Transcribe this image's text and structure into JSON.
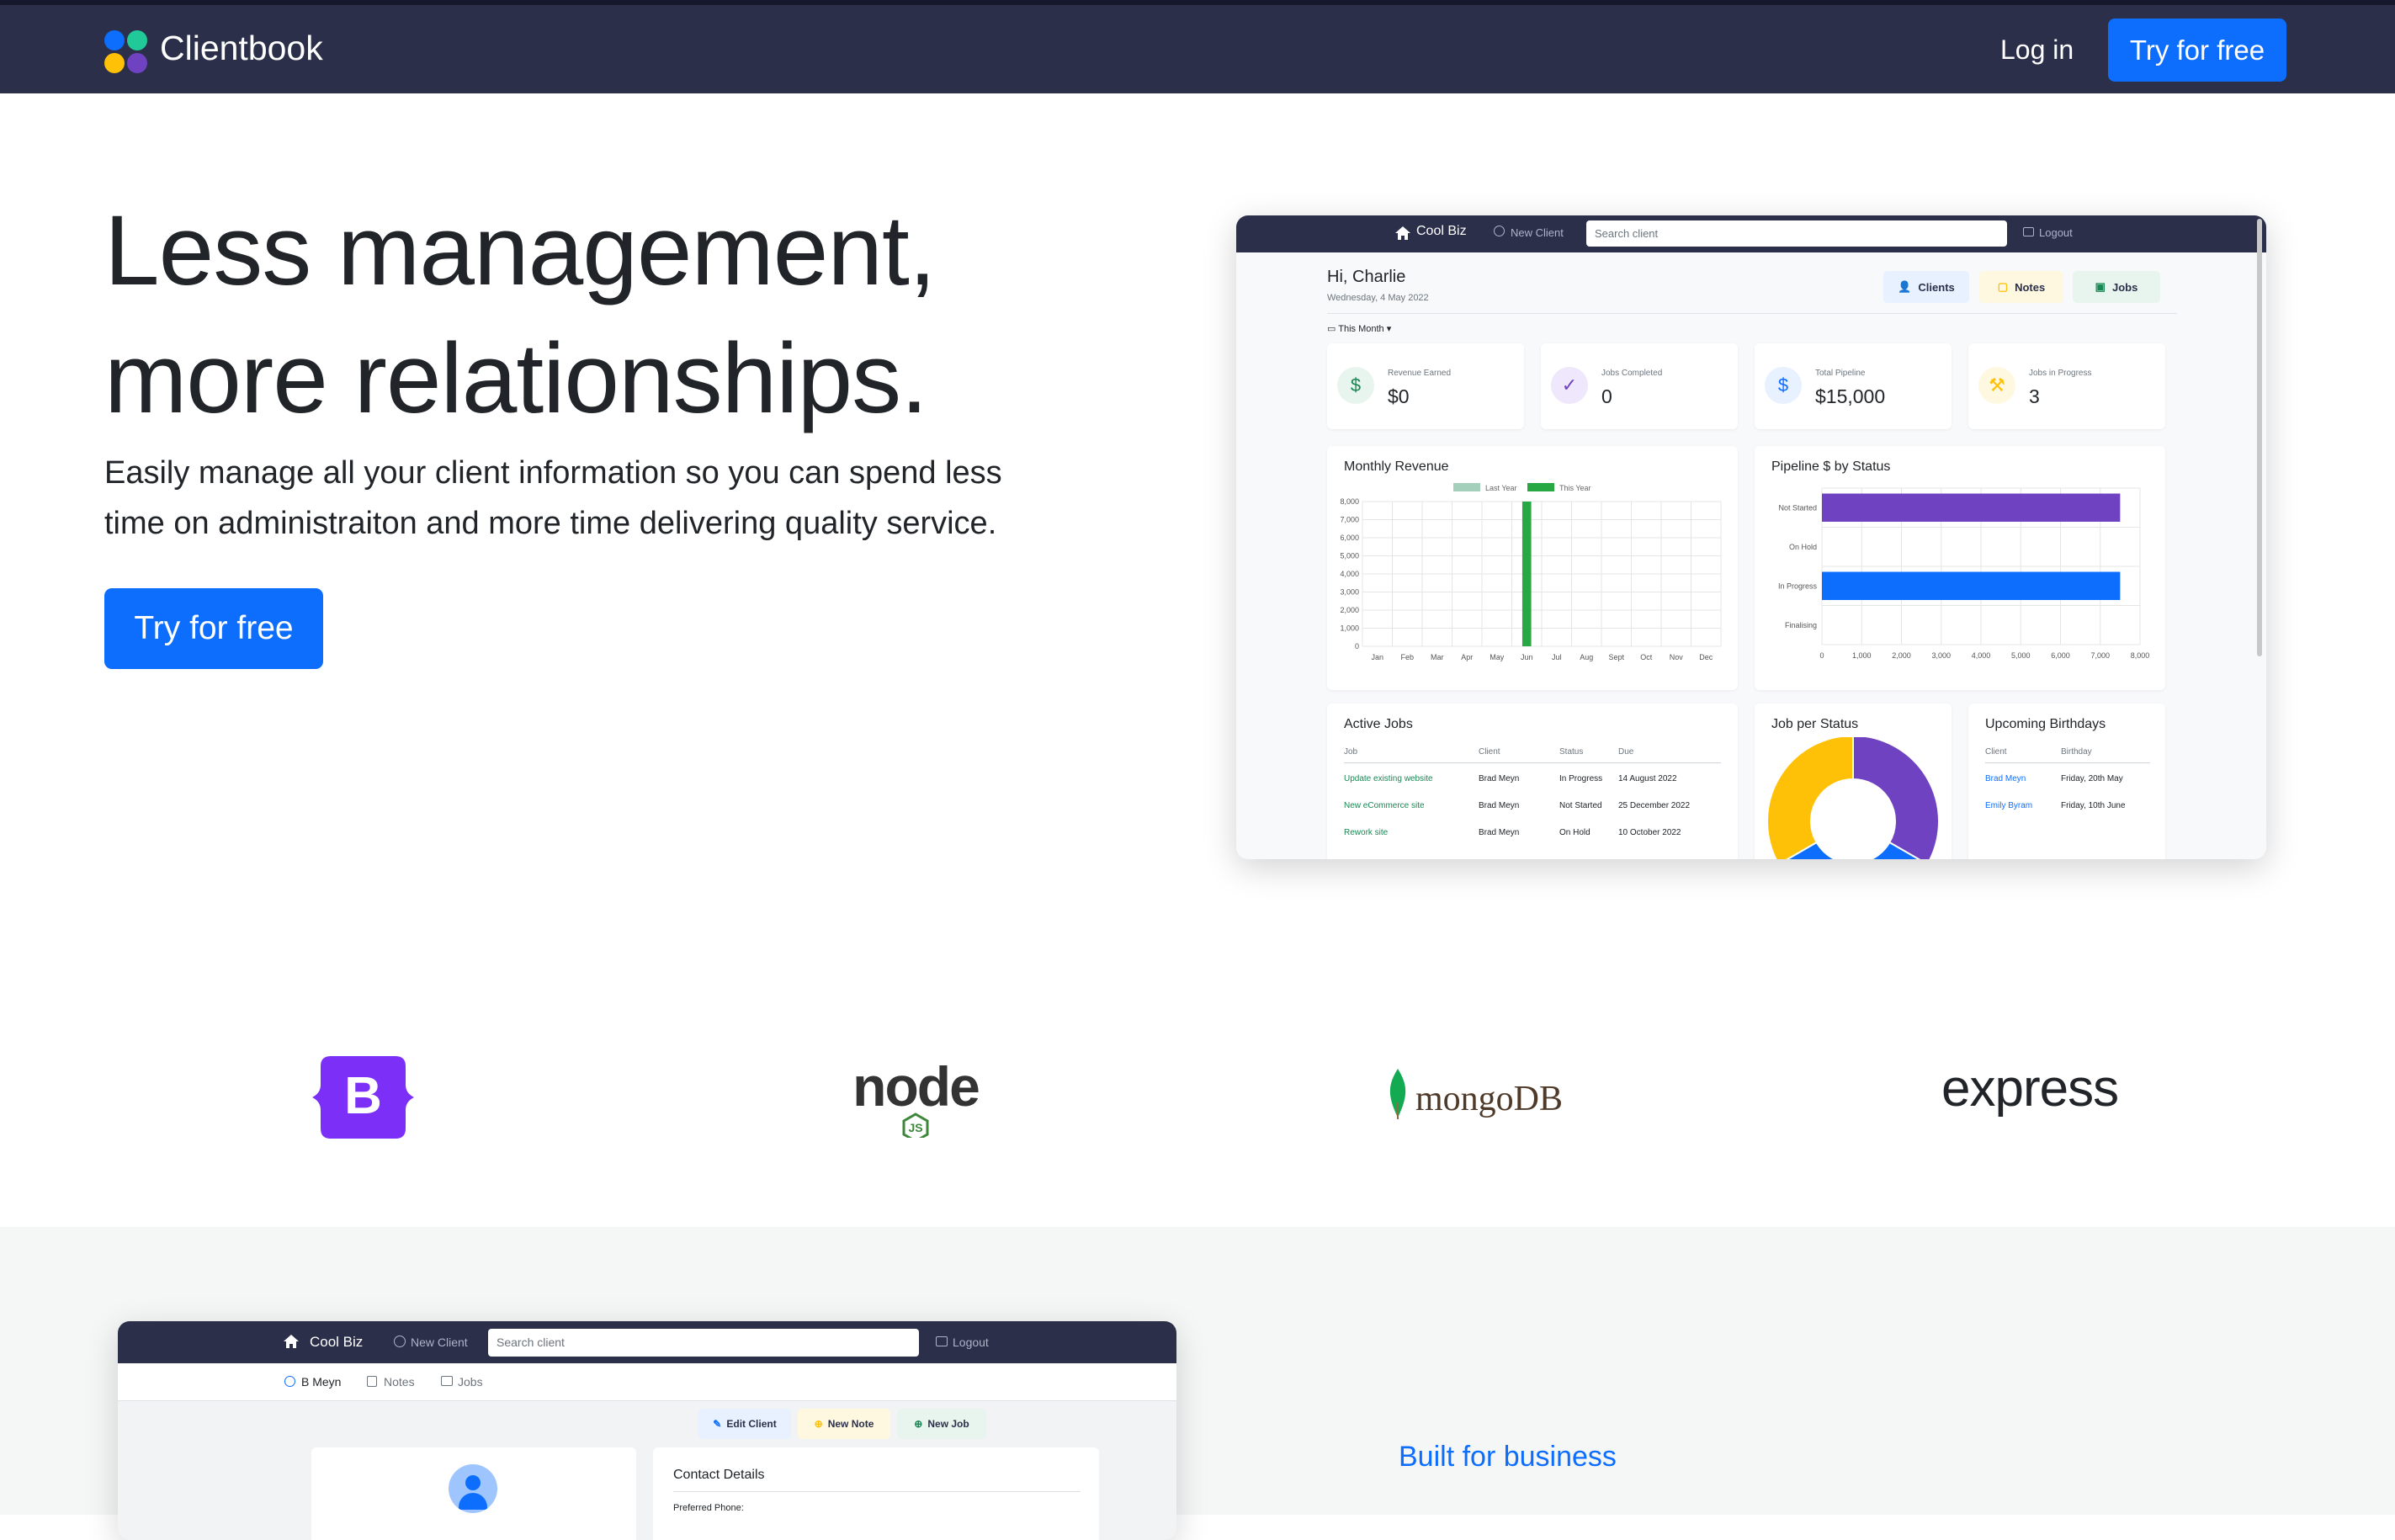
{
  "navbar": {
    "brand": "Clientbook",
    "login": "Log in",
    "cta": "Try for free",
    "colors": {
      "bg": "#2b2f4a",
      "accent": "#0d6efd"
    }
  },
  "hero": {
    "title_line1": "Less management,",
    "title_line2": "more relationships.",
    "subtitle_line1": "Easily manage all your client information so you can spend less",
    "subtitle_line2": "time on administraiton and more time delivering quality service.",
    "cta": "Try for free"
  },
  "dashboard": {
    "nav": {
      "brand": "Cool Biz",
      "new_client": "New Client",
      "search_placeholder": "Search client",
      "logout": "Logout"
    },
    "greeting": "Hi, Charlie",
    "date": "Wednesday, 4 May 2022",
    "pills": {
      "clients": "Clients",
      "notes": "Notes",
      "jobs": "Jobs"
    },
    "period": "This Month",
    "stats": [
      {
        "label": "Revenue Earned",
        "value": "$0",
        "icon": "dollar-icon"
      },
      {
        "label": "Jobs Completed",
        "value": "0",
        "icon": "check-icon"
      },
      {
        "label": "Total Pipeline",
        "value": "$15,000",
        "icon": "hand-dollar-icon"
      },
      {
        "label": "Jobs in Progress",
        "value": "3",
        "icon": "progress-icon"
      }
    ],
    "active_jobs": {
      "title": "Active Jobs",
      "headers": [
        "Job",
        "Client",
        "Status",
        "Due"
      ],
      "rows": [
        [
          "Update existing website",
          "Brad Meyn",
          "In Progress",
          "14 August 2022"
        ],
        [
          "New eCommerce site",
          "Brad Meyn",
          "Not Started",
          "25 December 2022"
        ],
        [
          "Rework site",
          "Brad Meyn",
          "On Hold",
          "10 October 2022"
        ]
      ]
    },
    "job_status": {
      "title": "Job per Status"
    },
    "birthdays": {
      "title": "Upcoming Birthdays",
      "headers": [
        "Client",
        "Birthday"
      ],
      "rows": [
        [
          "Brad Meyn",
          "Friday, 20th May"
        ],
        [
          "Emily Byram",
          "Friday, 10th June"
        ]
      ]
    }
  },
  "chart_data": [
    {
      "type": "bar",
      "title": "Monthly Revenue",
      "categories": [
        "Jan",
        "Feb",
        "Mar",
        "Apr",
        "May",
        "Jun",
        "Jul",
        "Aug",
        "Sept",
        "Oct",
        "Nov",
        "Dec"
      ],
      "series": [
        {
          "name": "Last Year",
          "color": "#a3cfbb",
          "values": [
            0,
            0,
            0,
            0,
            0,
            0,
            0,
            0,
            0,
            0,
            0,
            0
          ]
        },
        {
          "name": "This Year",
          "color": "#28a745",
          "values": [
            0,
            0,
            0,
            0,
            0,
            8000,
            0,
            0,
            0,
            0,
            0,
            0
          ]
        }
      ],
      "ylim": [
        0,
        8000
      ],
      "yticks": [
        "8,000",
        "7,000",
        "6,000",
        "5,000",
        "4,000",
        "3,000",
        "2,000",
        "1,000",
        "0"
      ],
      "legend": "top",
      "grid": true
    },
    {
      "type": "bar",
      "orientation": "horizontal",
      "title": "Pipeline $ by Status",
      "categories": [
        "Not Started",
        "On Hold",
        "In Progress",
        "Finalising"
      ],
      "values": [
        7500,
        0,
        7500,
        0
      ],
      "colors": [
        "#6f42c1",
        "#6f42c1",
        "#0d6efd",
        "#0d6efd"
      ],
      "xlim": [
        0,
        8000
      ],
      "xticks": [
        "0",
        "1,000",
        "2,000",
        "3,000",
        "4,000",
        "5,000",
        "6,000",
        "7,000",
        "8,000"
      ],
      "grid": true
    },
    {
      "type": "pie",
      "title": "Job per Status",
      "slices": [
        {
          "value": 1,
          "color": "#6f42c1"
        },
        {
          "value": 1,
          "color": "#0d6efd"
        },
        {
          "value": 1,
          "color": "#ffc107"
        }
      ]
    }
  ],
  "tech_logos": {
    "bootstrap": "B",
    "node": "node",
    "node_js": "JS",
    "mongodb": "mongoDB",
    "express": "express"
  },
  "section2": {
    "mock": {
      "brand": "Cool Biz",
      "new_client": "New Client",
      "search_placeholder": "Search client",
      "logout": "Logout",
      "tabs": [
        "B Meyn",
        "Notes",
        "Jobs"
      ],
      "actions": {
        "edit": "Edit Client",
        "note": "New Note",
        "job": "New Job"
      },
      "contact_title": "Contact Details",
      "preferred_phone": "Preferred Phone:"
    },
    "heading": "Built for business"
  }
}
